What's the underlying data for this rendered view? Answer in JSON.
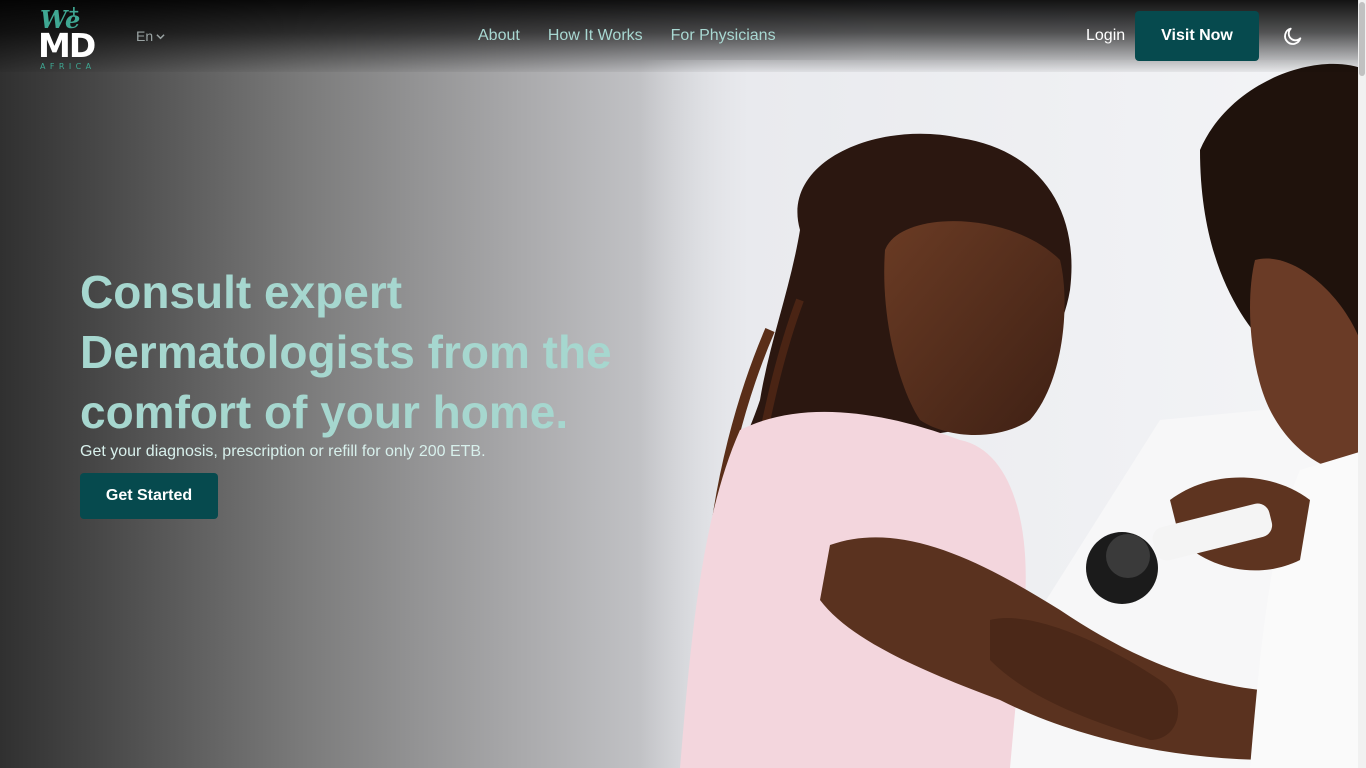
{
  "brand": {
    "logo_text_top": "We",
    "logo_text_main": "MD",
    "logo_text_sub": "AFRICA",
    "accent_color": "#3fa893"
  },
  "nav": {
    "language": "En",
    "links": [
      "About",
      "How It Works",
      "For Physicians"
    ],
    "login_label": "Login",
    "visit_label": "Visit Now",
    "theme_icon": "moon-icon"
  },
  "hero": {
    "headline": "Consult expert Dermatologists from the comfort of your home.",
    "subtext": "Get your diagnosis, prescription or refill for only 200 ETB.",
    "cta_label": "Get Started",
    "image": "photo of a dermatologist examining a girl's arm with a dermatoscope"
  },
  "colors": {
    "primary": "#064a4e",
    "headline": "#a6d7cf",
    "nav_link": "#a8d8d2"
  }
}
